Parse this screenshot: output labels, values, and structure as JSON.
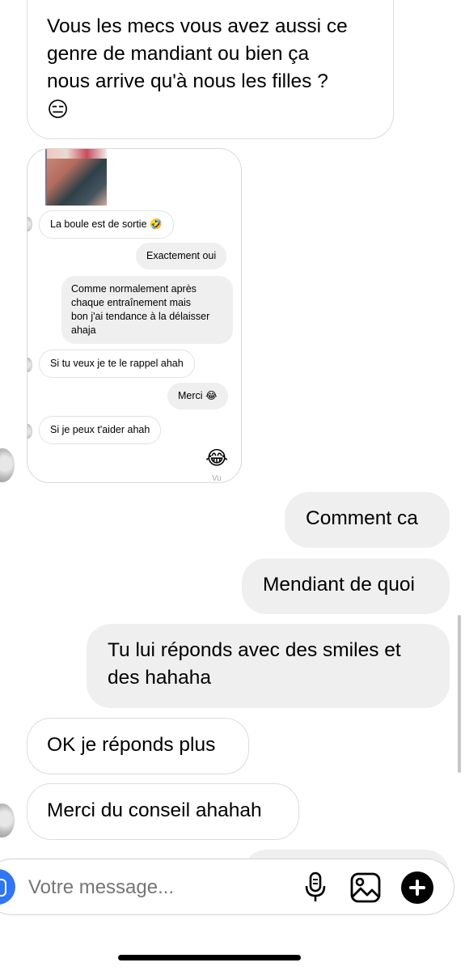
{
  "messages": {
    "m1": {
      "line1": "Vous les mecs vous avez aussi ce",
      "line2": "genre de mandiant ou bien ça",
      "line3": "nous arrive qu'à nous les filles ?",
      "emoji": "😑"
    },
    "m2": "Comment ca",
    "m3": "Mendiant de quoi",
    "m4": {
      "line1": "Tu lui réponds avec des smiles et",
      "line2": "des hahaha"
    },
    "m5": "OK je réponds plus",
    "m6": "Merci du conseil ahahah"
  },
  "embedded": {
    "in1": "La boule est de sortie 🤣",
    "out1": "Exactement oui",
    "out2": {
      "line1": "Comme normalement après",
      "line2": "chaque entraînement mais",
      "line3": "bon j'ai tendance à la délaisser",
      "line4": "ahaja"
    },
    "in2": "Si tu veux je te le rappel ahah",
    "out3": "Merci 😂",
    "in3": "Si je peux t'aider ahah",
    "emoji": "😂",
    "seen": "Vu"
  },
  "composer": {
    "placeholder": "Votre message..."
  },
  "icons": [
    "camera-icon",
    "microphone-icon",
    "gallery-icon",
    "plus-icon"
  ]
}
